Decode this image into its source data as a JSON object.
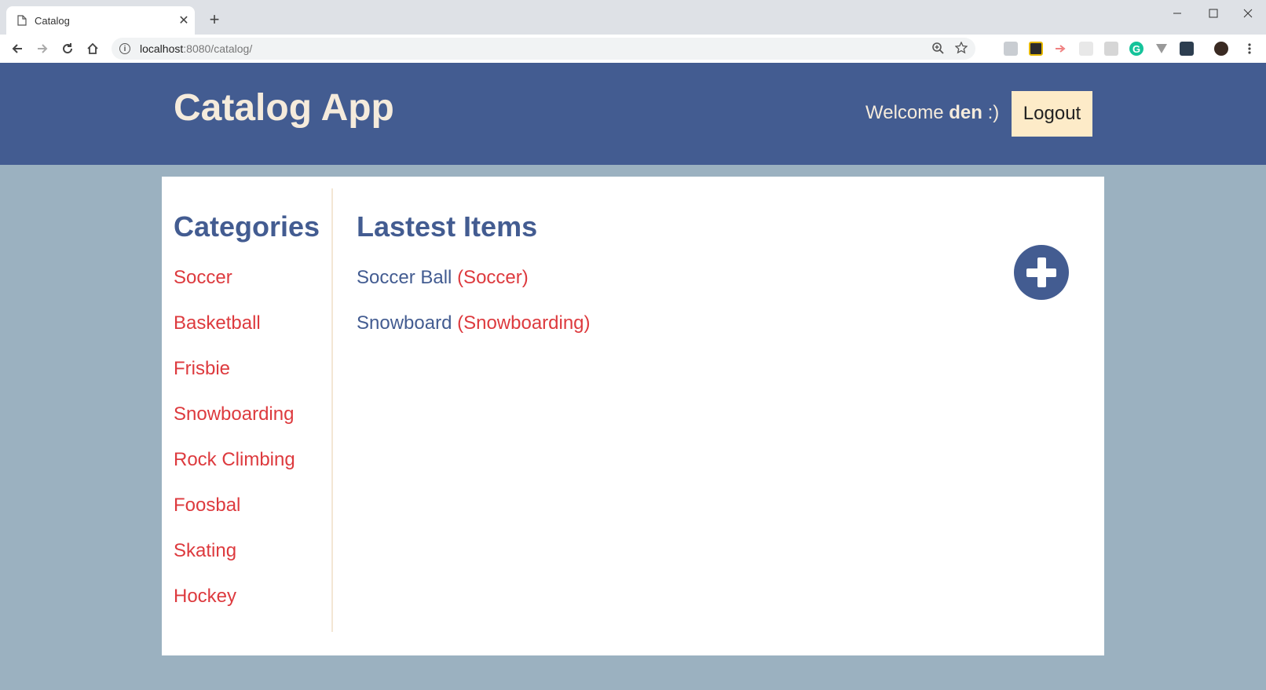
{
  "browser": {
    "tab_title": "Catalog",
    "url_host": "localhost",
    "url_rest": ":8080/catalog/"
  },
  "header": {
    "app_title": "Catalog App",
    "welcome_prefix": "Welcome",
    "username": "den",
    "welcome_suffix": ":)",
    "logout_label": "Logout"
  },
  "sidebar": {
    "title": "Categories",
    "categories": [
      "Soccer",
      "Basketball",
      "Frisbie",
      "Snowboarding",
      "Rock Climbing",
      "Foosbal",
      "Skating",
      "Hockey"
    ]
  },
  "main": {
    "title": "Lastest Items",
    "items": [
      {
        "name": "Soccer Ball",
        "category": "(Soccer)"
      },
      {
        "name": "Snowboard",
        "category": "(Snowboarding)"
      }
    ]
  },
  "colors": {
    "header_bg": "#435c91",
    "page_bg": "#9bb1c0",
    "accent_text": "#dd3a3e",
    "logout_bg": "#fdebc8"
  }
}
